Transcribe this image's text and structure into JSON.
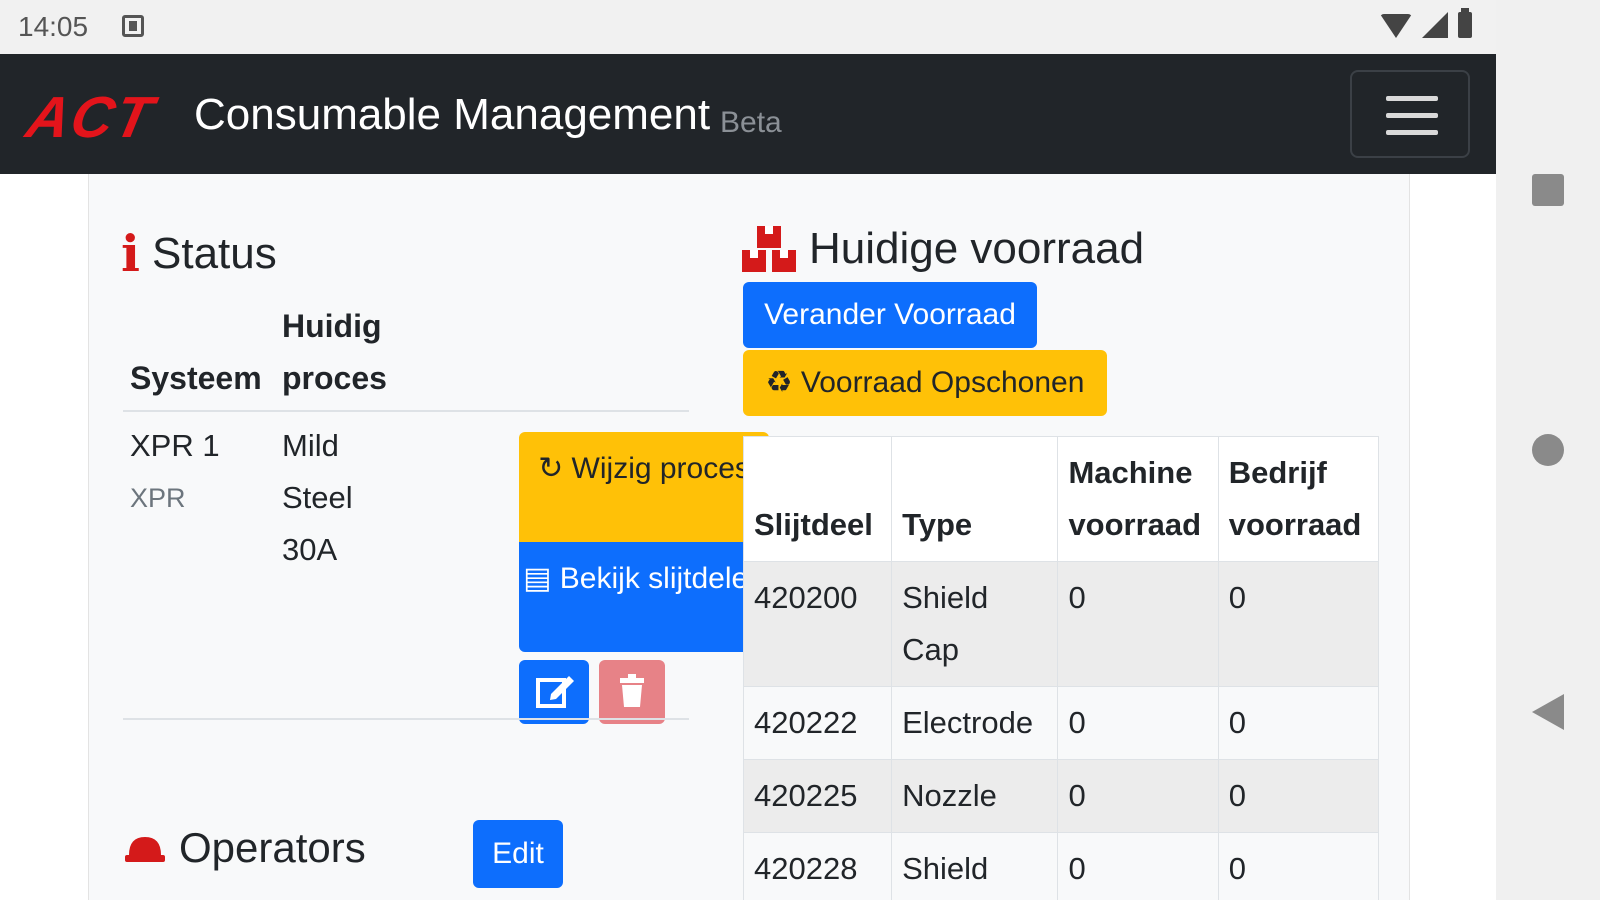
{
  "statusbar": {
    "time": "14:05"
  },
  "navbar": {
    "logo": "ACT",
    "title": "Consumable Management",
    "badge": "Beta"
  },
  "status": {
    "title": "Status",
    "col_system": "Systeem",
    "col_process_line1": "Huidig",
    "col_process_line2": "proces",
    "row": {
      "system": "XPR 1",
      "system_type": "XPR",
      "process": "Mild Steel 30A"
    },
    "btn_change_process": "Wijzig proces",
    "btn_view_parts": "Bekijk slijtdelen"
  },
  "operators": {
    "title": "Operators",
    "edit_label": "Edit"
  },
  "stock": {
    "title": "Huidige voorraad",
    "btn_change": "Verander Voorraad",
    "btn_clean": "Voorraad Opschonen",
    "headers": [
      "Slijtdeel",
      "Type",
      "Machine voorraad",
      "Bedrijf voorraad"
    ],
    "rows": [
      [
        "420200",
        "Shield Cap",
        "0",
        "0"
      ],
      [
        "420222",
        "Electrode",
        "0",
        "0"
      ],
      [
        "420225",
        "Nozzle",
        "0",
        "0"
      ],
      [
        "420228",
        "Shield",
        "0",
        "0"
      ]
    ]
  },
  "colors": {
    "accent": "#0d6efd",
    "warning": "#ffc107",
    "brand_red": "#e3141b",
    "navbar": "#212529"
  }
}
